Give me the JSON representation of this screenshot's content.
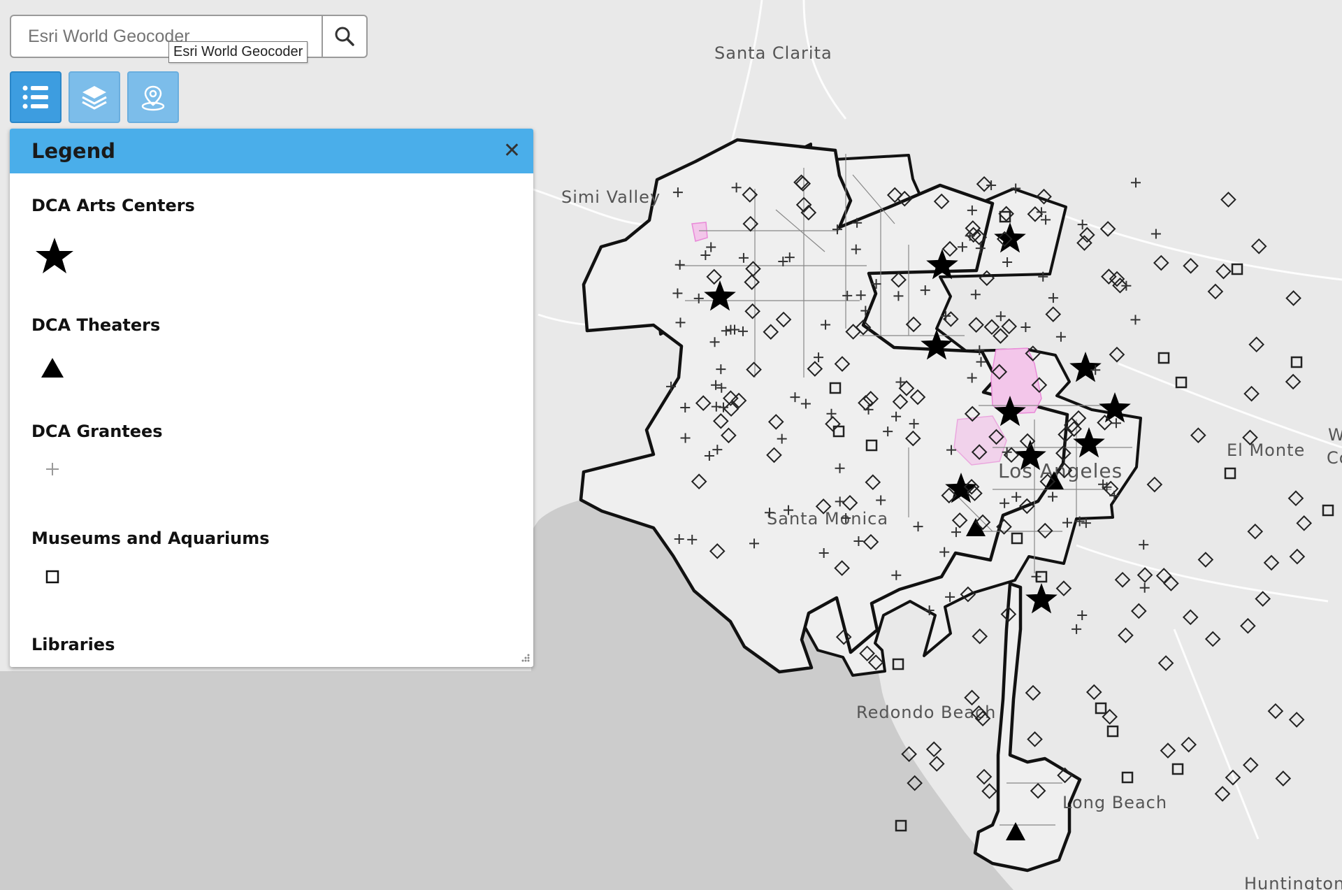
{
  "search": {
    "placeholder": "Esri World Geocoder",
    "tooltip": "Esri World Geocoder"
  },
  "toolbar": {
    "legend_icon": "list-icon",
    "layers_icon": "layers-icon",
    "locate_icon": "locate-pin-icon"
  },
  "legend": {
    "title": "Legend",
    "close_glyph": "✕",
    "items": [
      {
        "label": "DCA Arts Centers",
        "symbol": "star"
      },
      {
        "label": "DCA Theaters",
        "symbol": "triangle"
      },
      {
        "label": "DCA Grantees",
        "symbol": "plus"
      },
      {
        "label": "Museums and Aquariums",
        "symbol": "square"
      },
      {
        "label": "Libraries",
        "symbol": "diamond"
      }
    ]
  },
  "map": {
    "labels": [
      "Santa Clarita",
      "Simi Valley",
      "Los Angeles",
      "Santa Monica",
      "El Monte",
      "Redondo Beach",
      "Long Beach",
      "W",
      "Co",
      "Huntington"
    ],
    "colors": {
      "land": "#e9e9e9",
      "water": "#cccccc",
      "boundary": "#111111",
      "highlight": "#f3c6ea"
    }
  }
}
